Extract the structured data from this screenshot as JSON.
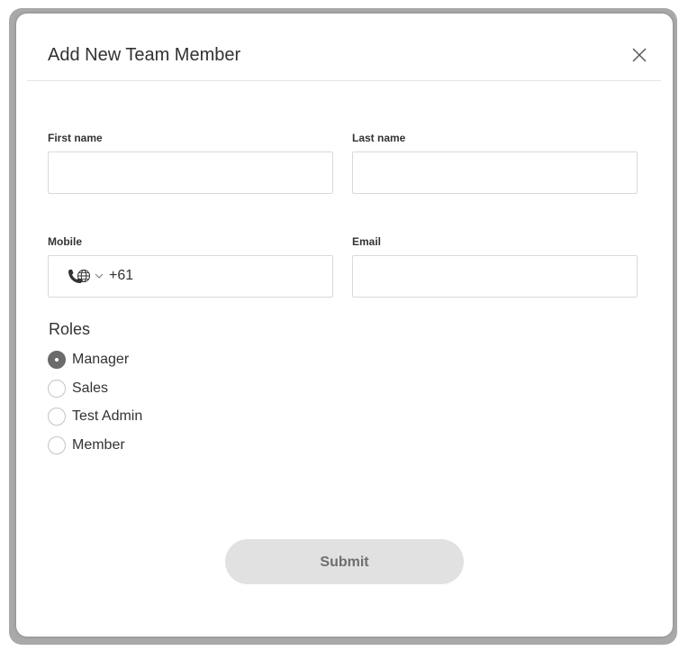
{
  "dialog": {
    "title": "Add New Team Member"
  },
  "form": {
    "first_name": {
      "label": "First name",
      "value": "",
      "placeholder": ""
    },
    "last_name": {
      "label": "Last name",
      "value": "",
      "placeholder": ""
    },
    "mobile": {
      "label": "Mobile",
      "country_code": "+61",
      "country_icon": "phone-globe-icon",
      "value": ""
    },
    "email": {
      "label": "Email",
      "value": "",
      "placeholder": ""
    }
  },
  "roles": {
    "heading": "Roles",
    "selected": "Manager",
    "items": [
      {
        "label": "Manager",
        "checked": true
      },
      {
        "label": "Sales",
        "checked": false
      },
      {
        "label": "Test Admin",
        "checked": false
      },
      {
        "label": "Member",
        "checked": false
      }
    ]
  },
  "submit_label": "Submit",
  "colors": {
    "frame": "#a9a9a9",
    "radio_checked": "#6b6b6b",
    "submit_bg": "#e1e1e1",
    "submit_text": "#6e6e6e"
  }
}
